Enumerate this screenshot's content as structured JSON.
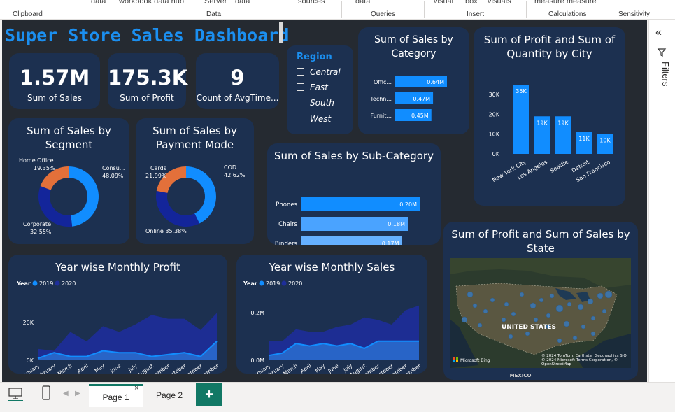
{
  "ribbon": {
    "items": [
      "data",
      "workbook data hub",
      "Server",
      "data",
      "sources",
      "data",
      "visual",
      "box",
      "visuals",
      "measure measure"
    ],
    "groups": [
      "Clipboard",
      "Data",
      "Queries",
      "Insert",
      "Calculations",
      "Sensitivity"
    ]
  },
  "dashboard": {
    "title": "Super Store Sales Dashboard"
  },
  "kpis": [
    {
      "value": "1.57M",
      "label": "Sum of Sales"
    },
    {
      "value": "175.3K",
      "label": "Sum of Profit"
    },
    {
      "value": "9",
      "label": "Count of AvgTime..."
    }
  ],
  "slicer": {
    "title": "Region",
    "items": [
      "Central",
      "East",
      "South",
      "West"
    ]
  },
  "category_chart": {
    "title": "Sum of Sales by Category",
    "bars": [
      {
        "label": "Offic...",
        "value": 0.64,
        "text": "0.64M"
      },
      {
        "label": "Techn...",
        "value": 0.47,
        "text": "0.47M"
      },
      {
        "label": "Furnit...",
        "value": 0.45,
        "text": "0.45M"
      }
    ]
  },
  "city_chart": {
    "title": "Sum of Profit and Sum of Quantity by City",
    "yticks": [
      "30K",
      "20K",
      "10K",
      "0K"
    ],
    "bars": [
      {
        "label": "New York City",
        "value": 35,
        "text": "35K"
      },
      {
        "label": "Los Angeles",
        "value": 19,
        "text": "19K"
      },
      {
        "label": "Seattle",
        "value": 19,
        "text": "19K"
      },
      {
        "label": "Detroit",
        "value": 11,
        "text": "11K"
      },
      {
        "label": "San Francisco",
        "value": 10,
        "text": "10K"
      }
    ]
  },
  "segment_chart": {
    "title": "Sum of Sales by Segment",
    "slices": [
      {
        "label": "Consu...",
        "pct": "48.09%",
        "value": 48.09
      },
      {
        "label": "Corporate",
        "pct": "32.55%",
        "value": 32.55
      },
      {
        "label": "Home Office",
        "pct": "19.35%",
        "value": 19.35
      }
    ]
  },
  "payment_chart": {
    "title": "Sum of Sales by Payment Mode",
    "slices": [
      {
        "label": "COD",
        "pct": "42.62%",
        "value": 42.62
      },
      {
        "label": "Online",
        "pct": "35.38%",
        "value": 35.38
      },
      {
        "label": "Cards",
        "pct": "21.99%",
        "value": 21.99
      }
    ]
  },
  "subcat_chart": {
    "title": "Sum of Sales by Sub-Category",
    "bars": [
      {
        "label": "Phones",
        "value": 0.2,
        "text": "0.20M"
      },
      {
        "label": "Chairs",
        "value": 0.18,
        "text": "0.18M"
      },
      {
        "label": "Binders",
        "value": 0.17,
        "text": "0.17M"
      }
    ]
  },
  "map_card": {
    "title": "Sum of Profit and Sum of Sales by State",
    "country_label": "UNITED STATES",
    "mexico_label": "MEXICO",
    "bing": "Microsoft Bing",
    "attribution": "© 2024 TomTom, Earthstar Geographics SIO, © 2024 Microsoft Terms Corporation, © OpenStreetMap"
  },
  "months": [
    "January",
    "February",
    "March",
    "April",
    "May",
    "June",
    "July",
    "August",
    "September",
    "October",
    "November",
    "December"
  ],
  "profit_chart": {
    "title": "Year wise Monthly Profit",
    "legend_title": "Year",
    "series_names": [
      "2019",
      "2020"
    ],
    "yticks": [
      "20K",
      "0K"
    ]
  },
  "sales_chart": {
    "title": "Year wise Monthly Sales",
    "legend_title": "Year",
    "series_names": [
      "2019",
      "2020"
    ],
    "yticks": [
      "0.2M",
      "0.0M"
    ]
  },
  "chart_data": [
    {
      "type": "bar",
      "title": "Sum of Sales by Category",
      "categories": [
        "Offic...",
        "Techn...",
        "Furnit..."
      ],
      "values": [
        0.64,
        0.47,
        0.45
      ]
    },
    {
      "type": "bar",
      "title": "Sum of Profit and Sum of Quantity by City",
      "categories": [
        "New York City",
        "Los Angeles",
        "Seattle",
        "Detroit",
        "San Francisco"
      ],
      "values": [
        35,
        19,
        19,
        11,
        10
      ],
      "ylim": [
        0,
        35
      ]
    },
    {
      "type": "pie",
      "title": "Sum of Sales by Segment",
      "categories": [
        "Consu...",
        "Corporate",
        "Home Office"
      ],
      "values": [
        48.09,
        32.55,
        19.35
      ]
    },
    {
      "type": "pie",
      "title": "Sum of Sales by Payment Mode",
      "categories": [
        "COD",
        "Online",
        "Cards"
      ],
      "values": [
        42.62,
        35.38,
        21.99
      ]
    },
    {
      "type": "bar",
      "title": "Sum of Sales by Sub-Category",
      "categories": [
        "Phones",
        "Chairs",
        "Binders"
      ],
      "values": [
        0.2,
        0.18,
        0.17
      ]
    },
    {
      "type": "area",
      "title": "Year wise Monthly Profit",
      "x": [
        "January",
        "February",
        "March",
        "April",
        "May",
        "June",
        "July",
        "August",
        "September",
        "October",
        "November",
        "December"
      ],
      "series": [
        {
          "name": "2019",
          "values": [
            1,
            4,
            2,
            2,
            5,
            4,
            4,
            2,
            3,
            4,
            2,
            10
          ]
        },
        {
          "name": "2020",
          "values": [
            6,
            5,
            15,
            10,
            18,
            15,
            19,
            24,
            22,
            22,
            16,
            25
          ]
        }
      ],
      "ylim": [
        0,
        30
      ]
    },
    {
      "type": "area",
      "title": "Year wise Monthly Sales",
      "x": [
        "January",
        "February",
        "March",
        "April",
        "May",
        "June",
        "July",
        "August",
        "September",
        "October",
        "November",
        "December"
      ],
      "series": [
        {
          "name": "2019",
          "values": [
            0.02,
            0.03,
            0.07,
            0.06,
            0.07,
            0.06,
            0.07,
            0.05,
            0.08,
            0.08,
            0.08,
            0.08
          ]
        },
        {
          "name": "2020",
          "values": [
            0.08,
            0.08,
            0.13,
            0.12,
            0.12,
            0.14,
            0.15,
            0.18,
            0.17,
            0.15,
            0.21,
            0.23
          ]
        }
      ],
      "ylim": [
        0,
        0.25
      ]
    }
  ],
  "filters": {
    "label": "Filters"
  },
  "pages": [
    "Page 1",
    "Page 2"
  ],
  "colors": {
    "bar": "#118dff",
    "accent": "#1b8ff0",
    "card": "#1c3050",
    "canvas": "#252a31",
    "dark": "#1e2e9a",
    "orange": "#e3703a"
  }
}
